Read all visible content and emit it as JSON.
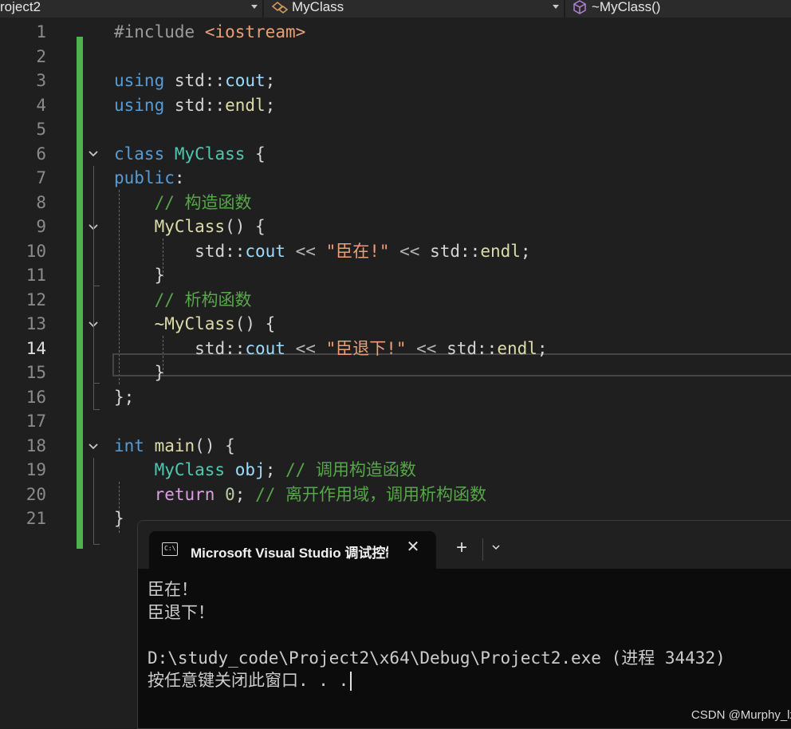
{
  "navbar": {
    "project": "roject2",
    "scope": "MyClass",
    "member": "~MyClass()"
  },
  "editor": {
    "line_numbers": [
      "1",
      "2",
      "3",
      "4",
      "5",
      "6",
      "7",
      "8",
      "9",
      "10",
      "11",
      "12",
      "13",
      "14",
      "15",
      "16",
      "17",
      "18",
      "19",
      "20",
      "21"
    ],
    "current_line": "14",
    "code": {
      "l1_pre": "#include",
      "l1_inc": "<iostream>",
      "l3_kw": "using",
      "l3_ns": "std::",
      "l3_id": "cout",
      "l3_end": ";",
      "l4_kw": "using",
      "l4_ns": "std::",
      "l4_id": "endl",
      "l4_end": ";",
      "l6_kw": "class",
      "l6_type": "MyClass",
      "l6_brace": "{",
      "l7_kw": "public",
      "l7_colon": ":",
      "l8_comment": "// 构造函数",
      "l9_fn": "MyClass",
      "l9_rest": "() {",
      "l10_ns": "std::",
      "l10_id": "cout",
      "l10_op": "<<",
      "l10_str": "\"臣在!\"",
      "l10_op2": "<<",
      "l10_ns2": "std::",
      "l10_id2": "endl",
      "l10_end": ";",
      "l11_brace": "}",
      "l12_comment": "// 析构函数",
      "l13_fn": "~MyClass",
      "l13_rest": "() {",
      "l14_ns": "std::",
      "l14_id": "cout",
      "l14_op": "<<",
      "l14_str": "\"臣退下!\"",
      "l14_op2": "<<",
      "l14_ns2": "std::",
      "l14_id2": "endl",
      "l14_end": ";",
      "l15_brace": "}",
      "l16_end": "};",
      "l18_kw": "int",
      "l18_fn": "main",
      "l18_rest": "() {",
      "l19_type": "MyClass",
      "l19_var": "obj",
      "l19_end": ";",
      "l19_comment": "// 调用构造函数",
      "l20_kw": "return",
      "l20_num": "0",
      "l20_end": ";",
      "l20_comment": "// 离开作用域，调用析构函数",
      "l21_brace": "}"
    }
  },
  "terminal": {
    "tab_title": "Microsoft Visual Studio 调试控制台",
    "close_glyph": "✕",
    "new_tab_glyph": "+",
    "icon_text": "C:\\",
    "lines": [
      "臣在！",
      "臣退下！",
      "",
      "D:\\study_code\\Project2\\x64\\Debug\\Project2.exe (进程 34432)",
      "按任意键关闭此窗口. . ."
    ]
  },
  "watermark": "CSDN @Murphy_lx",
  "colors": {
    "background": "#1f1f1f",
    "change_bar": "#4eb24e",
    "keyword": "#569cd6",
    "type": "#4ec9b0",
    "function": "#dcdcaa",
    "string": "#e8a07a",
    "comment": "#57a64a",
    "control_keyword": "#d8a0df"
  }
}
